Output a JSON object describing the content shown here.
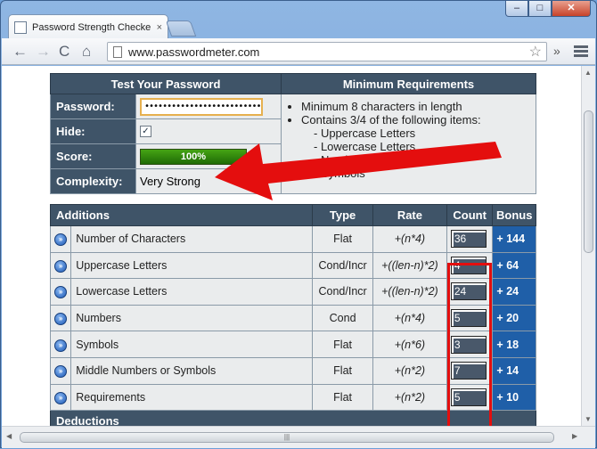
{
  "browser": {
    "tab_title": "Password Strength Checke",
    "tab_close": "×",
    "url": "www.passwordmeter.com",
    "controls": {
      "back": "←",
      "forward": "→",
      "reload": "C",
      "home": "⌂",
      "star": "☆",
      "more": "»"
    },
    "caption": {
      "minimize": "–",
      "maximize": "□",
      "close": "✕"
    }
  },
  "test": {
    "header": "Test Your Password",
    "password_label": "Password:",
    "password_value": "••••••••••••••••••••••••••••••",
    "hide_label": "Hide:",
    "hide_checked": "✓",
    "score_label": "Score:",
    "score_value": "100%",
    "complexity_label": "Complexity:",
    "complexity_value": "Very Strong"
  },
  "requirements": {
    "header": "Minimum Requirements",
    "item1": "Minimum 8 characters in length",
    "item2": "Contains 3/4 of the following items:",
    "sub1": "- Uppercase Letters",
    "sub2": "- Lowercase Letters",
    "sub3": "- Numbers",
    "sub4": "- Symbols"
  },
  "additions": {
    "headers": {
      "name": "Additions",
      "type": "Type",
      "rate": "Rate",
      "count": "Count",
      "bonus": "Bonus"
    },
    "rows": [
      {
        "name": "Number of Characters",
        "type": "Flat",
        "rate": "+(n*4)",
        "count": "36",
        "bonus": "+ 144"
      },
      {
        "name": "Uppercase Letters",
        "type": "Cond/Incr",
        "rate": "+((len-n)*2)",
        "count": "4",
        "bonus": "+ 64"
      },
      {
        "name": "Lowercase Letters",
        "type": "Cond/Incr",
        "rate": "+((len-n)*2)",
        "count": "24",
        "bonus": "+ 24"
      },
      {
        "name": "Numbers",
        "type": "Cond",
        "rate": "+(n*4)",
        "count": "5",
        "bonus": "+ 20"
      },
      {
        "name": "Symbols",
        "type": "Flat",
        "rate": "+(n*6)",
        "count": "3",
        "bonus": "+ 18"
      },
      {
        "name": "Middle Numbers or Symbols",
        "type": "Flat",
        "rate": "+(n*2)",
        "count": "7",
        "bonus": "+ 14"
      },
      {
        "name": "Requirements",
        "type": "Flat",
        "rate": "+(n*2)",
        "count": "5",
        "bonus": "+ 10"
      }
    ],
    "row_icon": "»",
    "deductions_header": "Deductions"
  },
  "colors": {
    "header_bg": "#3f5468",
    "bonus_bg": "#1f5fa8",
    "highlight": "#e40e0e",
    "score_green": "#2f8a0c"
  }
}
